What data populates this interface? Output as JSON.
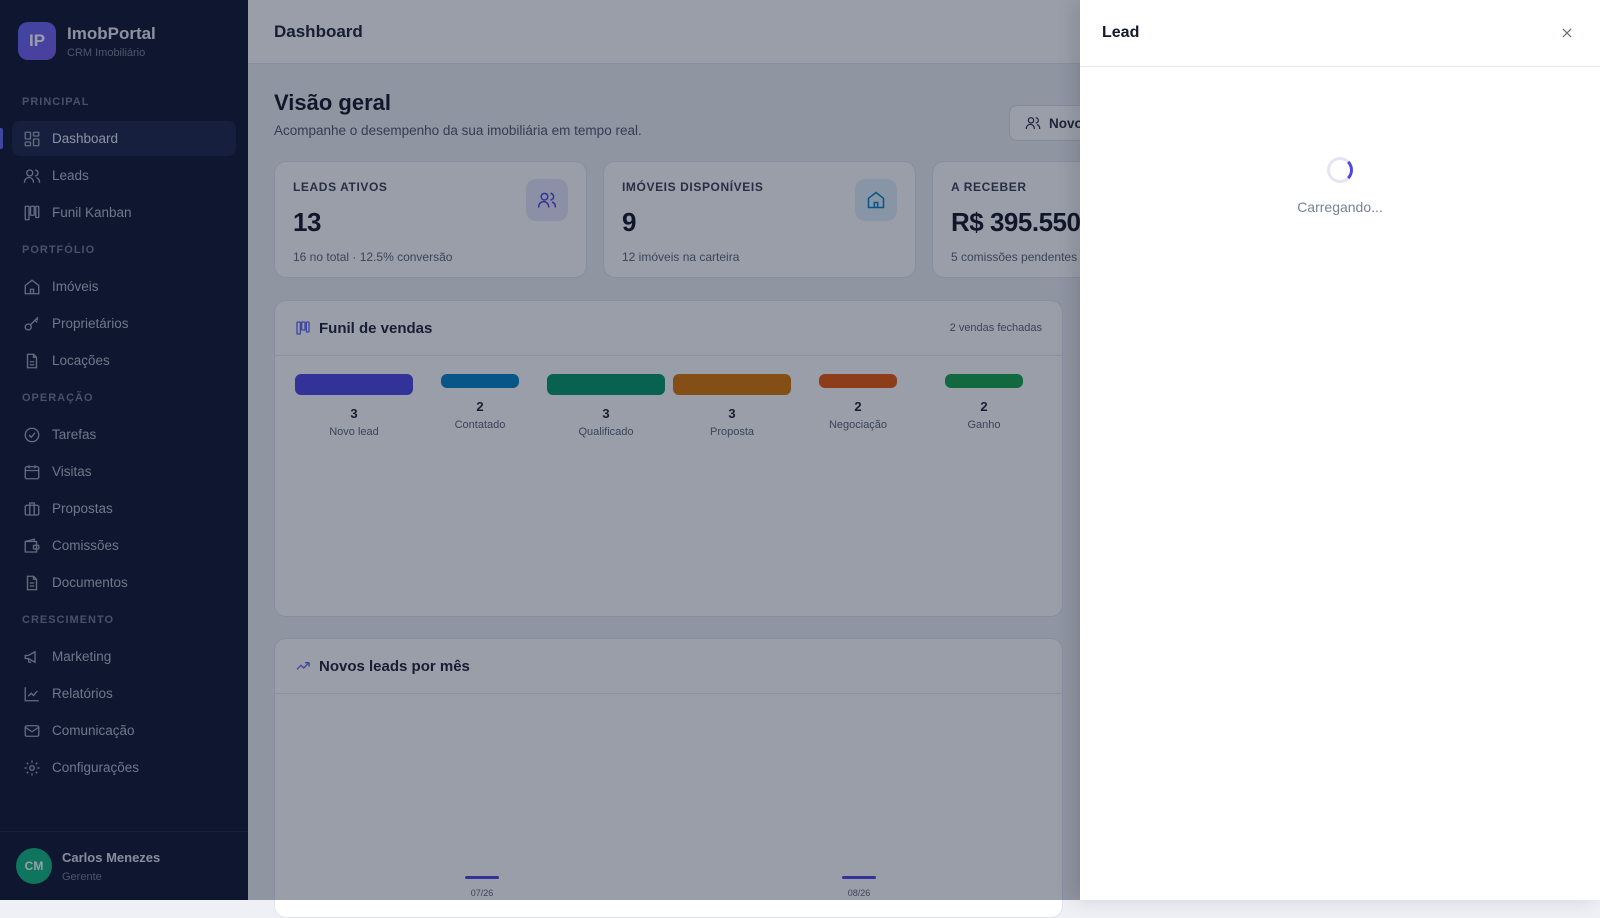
{
  "brand": {
    "logo": "IP",
    "name": "ImobPortal",
    "subtitle": "CRM Imobiliário"
  },
  "sidebar": {
    "sections": [
      {
        "title": "PRINCIPAL",
        "items": [
          {
            "label": "Dashboard",
            "icon": "dashboard-icon",
            "active": true
          },
          {
            "label": "Leads",
            "icon": "users-icon"
          },
          {
            "label": "Funil Kanban",
            "icon": "kanban-icon"
          }
        ]
      },
      {
        "title": "PORTFÓLIO",
        "items": [
          {
            "label": "Imóveis",
            "icon": "home-icon"
          },
          {
            "label": "Proprietários",
            "icon": "key-icon"
          },
          {
            "label": "Locações",
            "icon": "file-text-icon"
          }
        ]
      },
      {
        "title": "OPERAÇÃO",
        "items": [
          {
            "label": "Tarefas",
            "icon": "check-circle-icon"
          },
          {
            "label": "Visitas",
            "icon": "calendar-icon"
          },
          {
            "label": "Propostas",
            "icon": "briefcase-icon"
          },
          {
            "label": "Comissões",
            "icon": "wallet-icon"
          },
          {
            "label": "Documentos",
            "icon": "document-icon"
          }
        ]
      },
      {
        "title": "CRESCIMENTO",
        "items": [
          {
            "label": "Marketing",
            "icon": "megaphone-icon"
          },
          {
            "label": "Relatórios",
            "icon": "chart-line-icon"
          },
          {
            "label": "Comunicação",
            "icon": "mail-icon"
          },
          {
            "label": "Configurações",
            "icon": "gear-icon"
          }
        ]
      }
    ]
  },
  "user": {
    "initials": "CM",
    "name": "Carlos Menezes",
    "role": "Gerente"
  },
  "topbar": {
    "title": "Dashboard"
  },
  "overview": {
    "title": "Visão geral",
    "subtitle": "Acompanhe o desempenho da sua imobiliária em tempo real.",
    "new_button": "Novo"
  },
  "stats": [
    {
      "label": "LEADS ATIVOS",
      "value": "13",
      "foot": "16 no total · 12.5% conversão",
      "icon": "users-icon",
      "tint": "#e6e7fb",
      "color": "#4f46e5"
    },
    {
      "label": "IMÓVEIS DISPONÍVEIS",
      "value": "9",
      "foot": "12 imóveis na carteira",
      "icon": "home-icon",
      "tint": "#dff0fb",
      "color": "#0284c7"
    },
    {
      "label": "A RECEBER",
      "value": "R$ 395.550",
      "foot": "5 comissões pendentes"
    }
  ],
  "funnel": {
    "title": "Funil de vendas",
    "meta": "2 vendas fechadas",
    "stages": [
      {
        "name": "Novo lead",
        "count": "3",
        "color": "#4f46e5"
      },
      {
        "name": "Contatado",
        "count": "2",
        "color": "#0284c7"
      },
      {
        "name": "Qualificado",
        "count": "3",
        "color": "#059669"
      },
      {
        "name": "Proposta",
        "count": "3",
        "color": "#d97706"
      },
      {
        "name": "Negociação",
        "count": "2",
        "color": "#ea580c"
      },
      {
        "name": "Ganho",
        "count": "2",
        "color": "#16a34a"
      }
    ]
  },
  "monthly": {
    "title": "Novos leads por mês",
    "months": [
      {
        "label": "07/26"
      },
      {
        "label": "08/26"
      }
    ]
  },
  "drawer": {
    "title": "Lead",
    "loading": "Carregando..."
  }
}
